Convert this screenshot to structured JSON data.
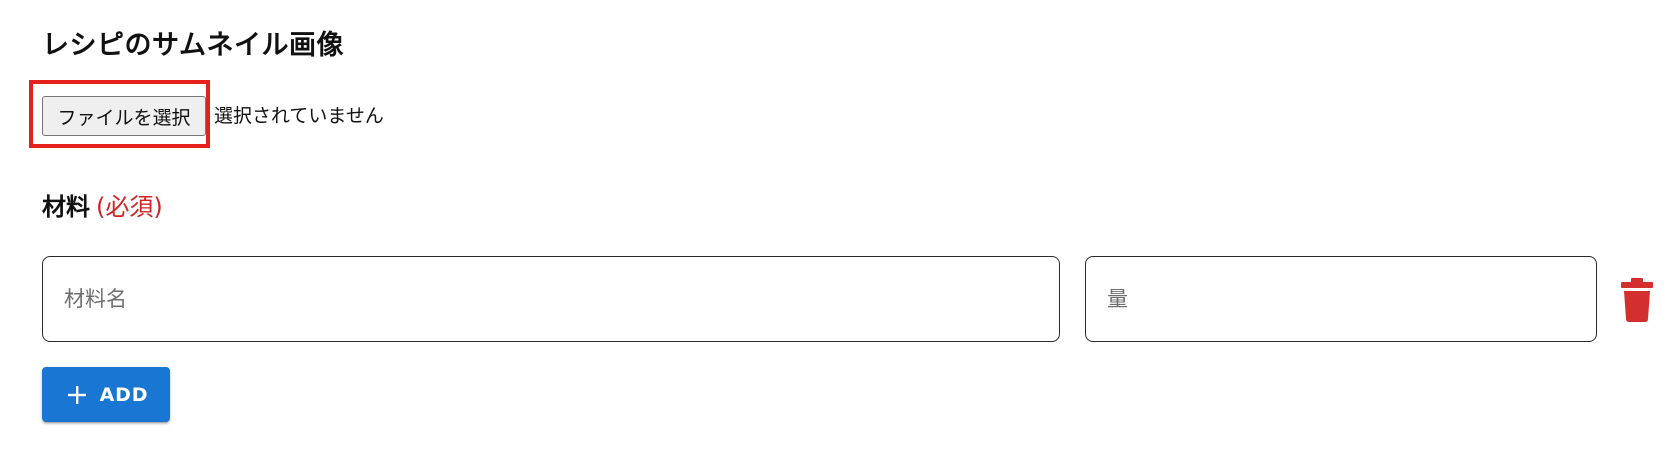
{
  "thumbnail": {
    "heading": "レシピのサムネイル画像",
    "file_button_label": "ファイルを選択",
    "file_status": "選択されていません"
  },
  "ingredients": {
    "heading": "材料",
    "required_label": "(必須)",
    "rows": [
      {
        "name": {
          "value": "",
          "placeholder": "材料名"
        },
        "amount": {
          "value": "",
          "placeholder": "量"
        }
      }
    ],
    "add_button_label": "ADD"
  },
  "icons": {
    "delete": "trash-icon",
    "add": "plus-icon"
  },
  "colors": {
    "highlight": "#e8201b",
    "required": "#d32222",
    "delete_icon": "#d32f2f",
    "add_button": "#1976d2"
  }
}
